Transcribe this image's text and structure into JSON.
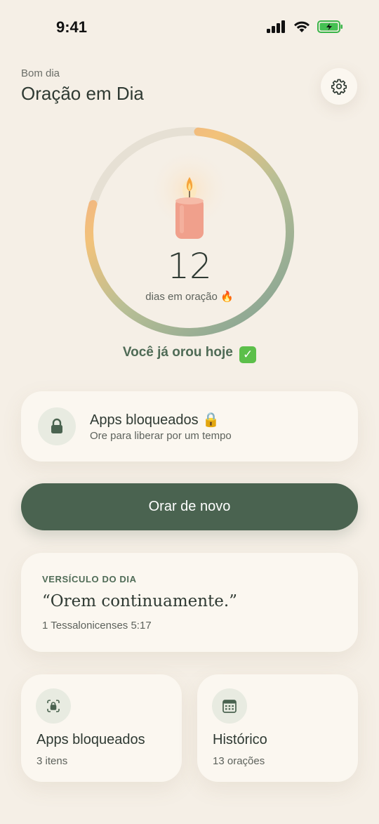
{
  "status": {
    "time": "9:41"
  },
  "header": {
    "greeting": "Bom dia",
    "title": "Oração em Dia",
    "settings_icon": "gear-icon"
  },
  "streak": {
    "count": "12",
    "label": "dias em oração 🔥",
    "progress": 0.78,
    "message": "Você já orou hoje",
    "message_icon": "check-mark-button-emoji"
  },
  "blocked_apps": {
    "title": "Apps bloqueados 🔒",
    "subtitle": "Ore para liberar por um tempo",
    "icon": "lock-icon"
  },
  "actions": {
    "pray_again": "Orar de novo"
  },
  "verse": {
    "heading": "VERSÍCULO DO DIA",
    "text": "“Orem continuamente.”",
    "reference": "1 Tessalonicenses 5:17"
  },
  "tiles": [
    {
      "title": "Apps bloqueados",
      "subtitle": "3 itens",
      "icon": "app-lock-icon"
    },
    {
      "title": "Histórico",
      "subtitle": "13 orações",
      "icon": "calendar-icon"
    }
  ],
  "colors": {
    "background": "#f5efe6",
    "card": "#fbf7f0",
    "primary": "#4a6350",
    "accent_text": "#4f6b56",
    "ring_track": "#e6e0d4",
    "ring_start": "#7fa093",
    "ring_mid": "#f2c27a",
    "ring_end": "#f0a68c",
    "candle": "#f0a08c"
  }
}
